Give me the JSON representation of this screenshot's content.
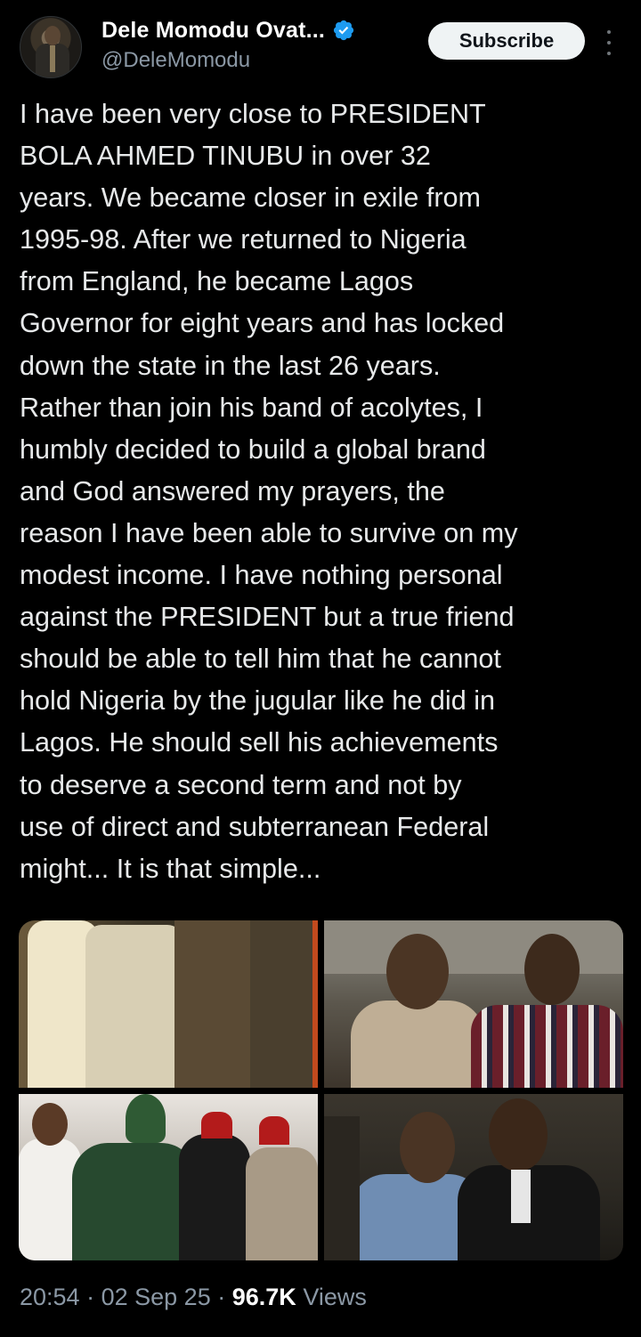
{
  "author": {
    "display_name": "Dele Momodu Ovat...",
    "handle": "@DeleMomodu",
    "verified_icon": "verified-badge-icon",
    "avatar": "profile-photo"
  },
  "actions": {
    "subscribe_label": "Subscribe",
    "more_icon": "more-vertical-icon"
  },
  "tweet": {
    "text": "I have been very close to PRESIDENT\nBOLA AHMED TINUBU in over 32\nyears. We became closer in exile from\n1995-98. After we returned to Nigeria\nfrom England, he became Lagos\nGovernor for eight years and has locked\ndown the state in the last 26 years.\nRather than join his band of acolytes, I\nhumbly decided to build a global brand\nand God answered my prayers, the\nreason I have been able to survive on my\nmodest income. I have nothing personal\nagainst the PRESIDENT but a true friend\nshould be able to tell him that he cannot\nhold Nigeria by the jugular like he did in\nLagos. He should sell his achievements\nto deserve a second term and not by\nuse of direct and subterranean Federal\nmight... It is that simple...",
    "media": [
      {
        "name": "photo-men-in-agbada"
      },
      {
        "name": "photo-two-men-smiling-outdoors"
      },
      {
        "name": "photo-group-embrace"
      },
      {
        "name": "photo-men-in-suits"
      }
    ]
  },
  "meta": {
    "time": "20:54",
    "separator": "·",
    "date": "02 Sep 25",
    "views_count": "96.7K",
    "views_label": "Views"
  },
  "colors": {
    "background": "#000000",
    "text": "#e7e9ea",
    "secondary_text": "#8b98a5",
    "verified": "#1d9bf0",
    "button_bg": "#eff3f4"
  }
}
